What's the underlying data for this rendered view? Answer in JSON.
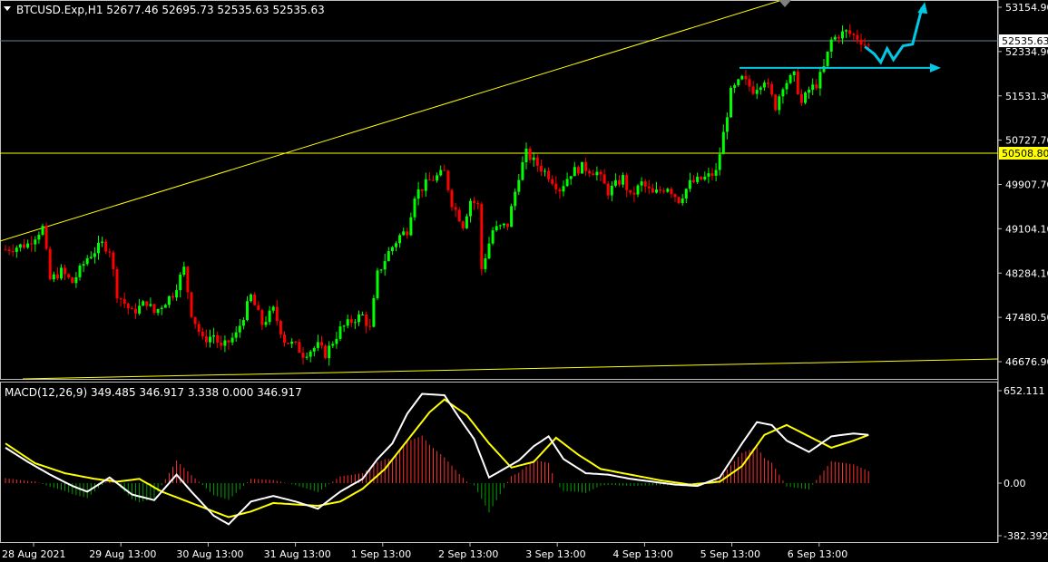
{
  "colors": {
    "background": "#000000",
    "frame": "#c0c0c0",
    "text": "#ffffff",
    "bull": "#00ff00",
    "bear": "#ff0000",
    "trend": "#ffff00",
    "signal": "#ffff00",
    "macd_line": "#ffffff",
    "hist_pos": "#ff3030",
    "hist_neg": "#00a000",
    "forecast": "#00c8e6",
    "price_line": "#708090",
    "level_label_bg": "#ffff00"
  },
  "header": {
    "icon": "triangle-down-icon",
    "text": "BTCUSD.Exp,H1  52677.46 52695.73 52535.63 52535.63"
  },
  "macd": {
    "title": "MACD(12,26,9) 349.485 346.917 3.338 0.000 346.917",
    "axis_labels": [
      "652.111",
      "0.00",
      "-382.392"
    ]
  },
  "chart_data": [
    {
      "type": "candlestick",
      "title": "BTCUSD.Exp,H1",
      "ohlc": {
        "open": 52677.46,
        "high": 52695.73,
        "low": 52535.63,
        "close": 52535.63
      },
      "y_ticks": [
        "53154.90",
        "52334.90",
        "51531.30",
        "50727.70",
        "49907.70",
        "49104.10",
        "48284.10",
        "47480.50",
        "46676.90"
      ],
      "y_range": [
        46500,
        53350
      ],
      "current_price": "52535.63",
      "level_label": "50508.80",
      "level_value": 50508.8,
      "x_labels": [
        "28 Aug 2021",
        "29 Aug 13:00",
        "30 Aug 13:00",
        "31 Aug 13:00",
        "1 Sep 13:00",
        "2 Sep 13:00",
        "3 Sep 13:00",
        "4 Sep 13:00",
        "5 Sep 13:00",
        "6 Sep 13:00"
      ],
      "hourly_path": [
        [
          0,
          48850
        ],
        [
          6,
          48950
        ],
        [
          10,
          49250
        ],
        [
          12,
          48300
        ],
        [
          15,
          48450
        ],
        [
          18,
          48250
        ],
        [
          22,
          48700
        ],
        [
          26,
          48950
        ],
        [
          28,
          48850
        ],
        [
          30,
          48050
        ],
        [
          34,
          47700
        ],
        [
          38,
          47900
        ],
        [
          40,
          47700
        ],
        [
          45,
          48050
        ],
        [
          48,
          48500
        ],
        [
          50,
          47700
        ],
        [
          53,
          47200
        ],
        [
          56,
          47300
        ],
        [
          58,
          47050
        ],
        [
          62,
          47300
        ],
        [
          66,
          48000
        ],
        [
          69,
          47500
        ],
        [
          72,
          47750
        ],
        [
          75,
          47200
        ],
        [
          78,
          47100
        ],
        [
          80,
          46950
        ],
        [
          84,
          47100
        ],
        [
          86,
          46950
        ],
        [
          90,
          47400
        ],
        [
          94,
          47600
        ],
        [
          96,
          47650
        ],
        [
          98,
          47400
        ],
        [
          100,
          48400
        ],
        [
          103,
          48800
        ],
        [
          106,
          49100
        ],
        [
          108,
          49200
        ],
        [
          110,
          49850
        ],
        [
          114,
          50100
        ],
        [
          118,
          50250
        ],
        [
          120,
          49700
        ],
        [
          123,
          49300
        ],
        [
          125,
          49750
        ],
        [
          127,
          49650
        ],
        [
          128,
          48500
        ],
        [
          131,
          49200
        ],
        [
          135,
          49300
        ],
        [
          138,
          50200
        ],
        [
          140,
          50600
        ],
        [
          142,
          50450
        ],
        [
          146,
          50200
        ],
        [
          149,
          49950
        ],
        [
          152,
          50250
        ],
        [
          155,
          50350
        ],
        [
          159,
          50250
        ],
        [
          162,
          49900
        ],
        [
          166,
          50150
        ],
        [
          168,
          49800
        ],
        [
          171,
          50050
        ],
        [
          174,
          49850
        ],
        [
          178,
          50000
        ],
        [
          181,
          49750
        ],
        [
          184,
          50050
        ],
        [
          188,
          50150
        ],
        [
          191,
          50250
        ],
        [
          193,
          50950
        ],
        [
          195,
          51700
        ],
        [
          198,
          51950
        ],
        [
          201,
          51750
        ],
        [
          204,
          51950
        ],
        [
          207,
          51450
        ],
        [
          209,
          51850
        ],
        [
          212,
          52000
        ],
        [
          214,
          51500
        ],
        [
          216,
          51750
        ],
        [
          218,
          51850
        ],
        [
          220,
          52150
        ],
        [
          222,
          52650
        ],
        [
          224,
          52750
        ],
        [
          226,
          52800
        ],
        [
          229,
          52700
        ],
        [
          232,
          52535
        ]
      ],
      "forecast_up": [
        [
          52535,
          0
        ],
        [
          52400,
          3
        ],
        [
          52250,
          5
        ],
        [
          52500,
          7
        ],
        [
          52300,
          9
        ],
        [
          52550,
          12
        ],
        [
          52580,
          15
        ],
        [
          53250,
          18
        ]
      ],
      "forecast_flat_value": 52150
    },
    {
      "type": "histogram+line",
      "title": "MACD(12,26,9)",
      "y_range": [
        -382.392,
        652.111
      ],
      "y_ticks": [
        "652.111",
        "0.00",
        "-382.392"
      ],
      "macd_path": [
        [
          0,
          250
        ],
        [
          6,
          150
        ],
        [
          12,
          60
        ],
        [
          18,
          -20
        ],
        [
          22,
          -60
        ],
        [
          28,
          40
        ],
        [
          34,
          -80
        ],
        [
          40,
          -120
        ],
        [
          46,
          60
        ],
        [
          50,
          -60
        ],
        [
          56,
          -230
        ],
        [
          60,
          -290
        ],
        [
          66,
          -130
        ],
        [
          72,
          -90
        ],
        [
          78,
          -130
        ],
        [
          84,
          -180
        ],
        [
          90,
          -60
        ],
        [
          96,
          30
        ],
        [
          100,
          170
        ],
        [
          104,
          280
        ],
        [
          108,
          490
        ],
        [
          112,
          630
        ],
        [
          118,
          620
        ],
        [
          122,
          460
        ],
        [
          126,
          310
        ],
        [
          130,
          40
        ],
        [
          134,
          100
        ],
        [
          138,
          160
        ],
        [
          142,
          260
        ],
        [
          146,
          330
        ],
        [
          150,
          170
        ],
        [
          156,
          70
        ],
        [
          162,
          60
        ],
        [
          168,
          30
        ],
        [
          174,
          10
        ],
        [
          180,
          -10
        ],
        [
          186,
          -20
        ],
        [
          192,
          40
        ],
        [
          198,
          280
        ],
        [
          202,
          430
        ],
        [
          206,
          410
        ],
        [
          210,
          300
        ],
        [
          216,
          220
        ],
        [
          222,
          330
        ],
        [
          228,
          350
        ],
        [
          232,
          340
        ]
      ],
      "signal_path": [
        [
          0,
          280
        ],
        [
          8,
          140
        ],
        [
          16,
          70
        ],
        [
          24,
          30
        ],
        [
          30,
          10
        ],
        [
          36,
          30
        ],
        [
          42,
          -60
        ],
        [
          48,
          -120
        ],
        [
          54,
          -180
        ],
        [
          60,
          -240
        ],
        [
          66,
          -200
        ],
        [
          72,
          -140
        ],
        [
          78,
          -150
        ],
        [
          84,
          -160
        ],
        [
          90,
          -130
        ],
        [
          96,
          -40
        ],
        [
          102,
          100
        ],
        [
          108,
          300
        ],
        [
          114,
          500
        ],
        [
          118,
          590
        ],
        [
          124,
          480
        ],
        [
          130,
          280
        ],
        [
          136,
          110
        ],
        [
          142,
          150
        ],
        [
          148,
          320
        ],
        [
          154,
          200
        ],
        [
          160,
          100
        ],
        [
          168,
          60
        ],
        [
          176,
          20
        ],
        [
          184,
          -10
        ],
        [
          192,
          10
        ],
        [
          198,
          120
        ],
        [
          204,
          340
        ],
        [
          210,
          410
        ],
        [
          216,
          330
        ],
        [
          222,
          250
        ],
        [
          228,
          300
        ],
        [
          232,
          340
        ]
      ]
    }
  ]
}
